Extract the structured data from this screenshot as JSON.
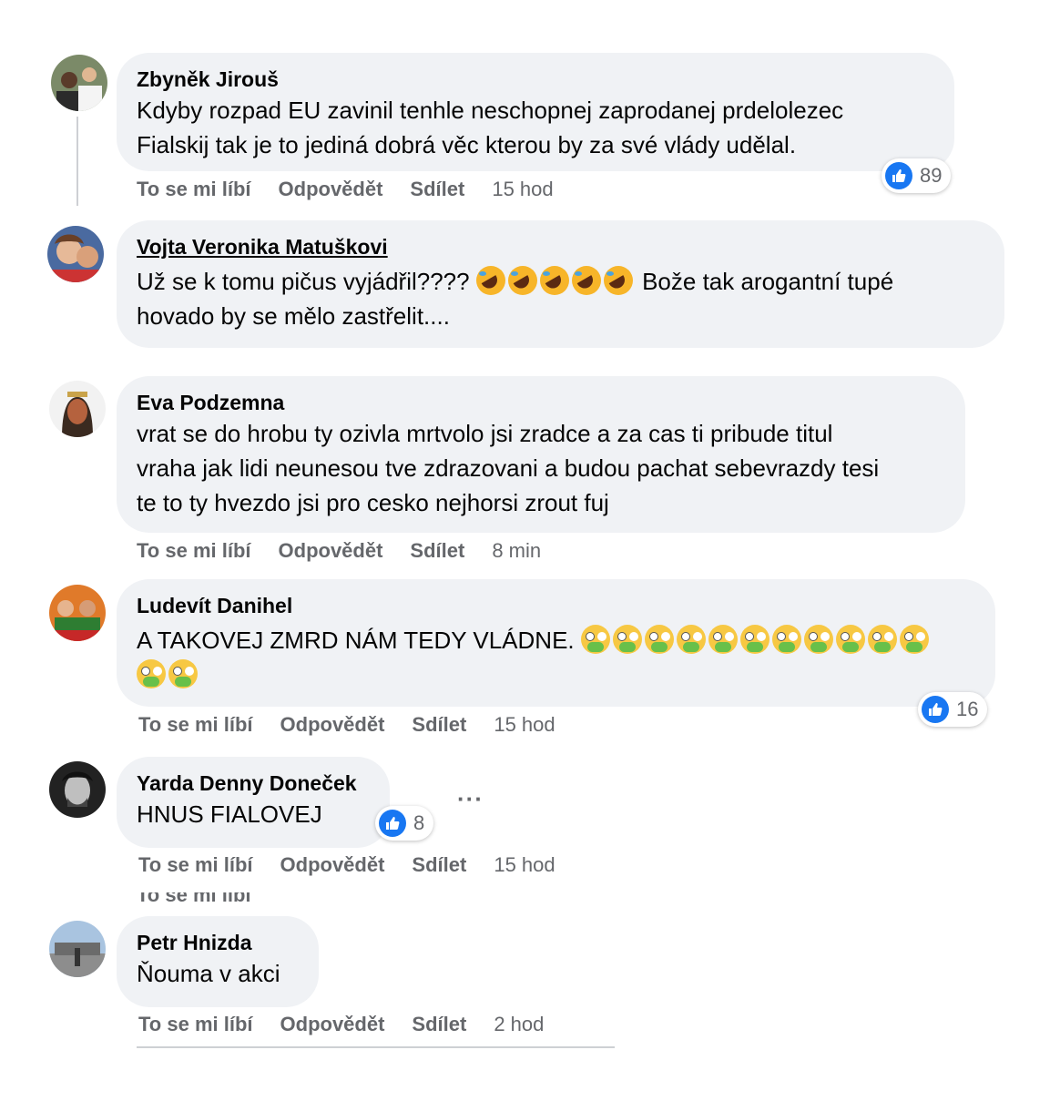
{
  "actions": {
    "like": "To se mi líbí",
    "reply": "Odpovědět",
    "share": "Sdílet"
  },
  "comments": [
    {
      "author": "Zbyněk Jirouš",
      "line1": "Kdyby rozpad EU zavinil tenhle neschopnej zaprodanej prdelolezec",
      "line2": "Fialskij tak je to jediná dobrá věc kterou by za své vlády udělal.",
      "time": "15 hod",
      "likes": "89"
    },
    {
      "author": "Vojta Veronika Matuškovi",
      "line1_before": "Už se k tomu pičus vyjádřil????",
      "line1_after": "Bože tak arogantní tupé",
      "line2": "hovado by se mělo zastřelit...."
    },
    {
      "author": "Eva Podzemna",
      "line1": "vrat se do hrobu ty ozivla mrtvolo jsi zradce a za cas ti pribude titul",
      "line2": "vraha jak lidi neunesou tve zdrazovani a budou pachat sebevrazdy tesi",
      "line3": "te to ty hvezdo jsi pro cesko nejhorsi zrout fuj",
      "time": "8 min"
    },
    {
      "author": "Ludevít Danihel",
      "line1": "A TAKOVEJ ZMRD NÁM TEDY VLÁDNE.",
      "time": "15 hod",
      "likes": "16"
    },
    {
      "author": "Yarda Denny Doneček",
      "line1": "HNUS FIALOVEJ",
      "time": "15 hod",
      "likes": "8",
      "more": "···"
    },
    {
      "author": "Petr Hnizda",
      "line1": "Ňouma v akci",
      "time": "2 hod"
    }
  ],
  "icons": {
    "like": "thumbs-up-icon",
    "rofl": "rolling-on-floor-laughing-emoji",
    "nausea": "nauseated-face-emoji"
  },
  "colors": {
    "bubble": "#f0f2f5",
    "like_blue": "#1877f2",
    "meta_gray": "#65676b"
  }
}
